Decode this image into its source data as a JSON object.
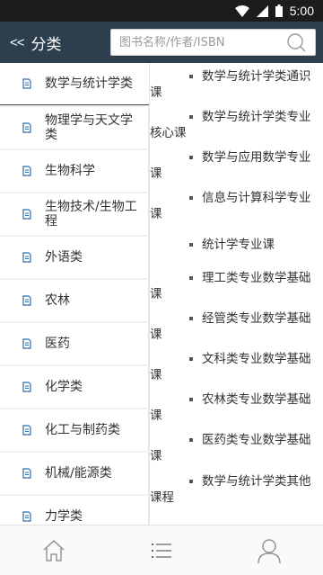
{
  "status_bar": {
    "time": "5:00"
  },
  "header": {
    "back_label": "<<",
    "title": "分类"
  },
  "search": {
    "placeholder": "图书名称/作者/ISBN",
    "value": ""
  },
  "categories": [
    {
      "label": "数学与统计学类",
      "selected": true
    },
    {
      "label": "物理学与天文学类",
      "selected": false
    },
    {
      "label": "生物科学",
      "selected": false
    },
    {
      "label": "生物技术/生物工程",
      "selected": false
    },
    {
      "label": "外语类",
      "selected": false
    },
    {
      "label": "农林",
      "selected": false
    },
    {
      "label": "医药",
      "selected": false
    },
    {
      "label": "化学类",
      "selected": false
    },
    {
      "label": "化工与制药类",
      "selected": false
    },
    {
      "label": "机械/能源类",
      "selected": false
    },
    {
      "label": "力学类",
      "selected": false
    }
  ],
  "subcategories": [
    "数学与统计学类通识课",
    "数学与统计学类专业核心课",
    "数学与应用数学专业课",
    "信息与计算科学专业课",
    "统计学专业课",
    "理工类专业数学基础课",
    "经管类专业数学基础课",
    "文科类专业数学基础课",
    "农林类专业数学基础课",
    "医药类专业数学基础课",
    "数学与统计学类其他课程"
  ],
  "tabs": [
    {
      "icon": "home-icon"
    },
    {
      "icon": "list-icon"
    },
    {
      "icon": "user-icon"
    }
  ],
  "colors": {
    "header_bg": "#2d3e4f",
    "status_bar_bg": "#1c1c1c",
    "active_underline": "#444444",
    "icon_blue": "#2f6fb0"
  }
}
